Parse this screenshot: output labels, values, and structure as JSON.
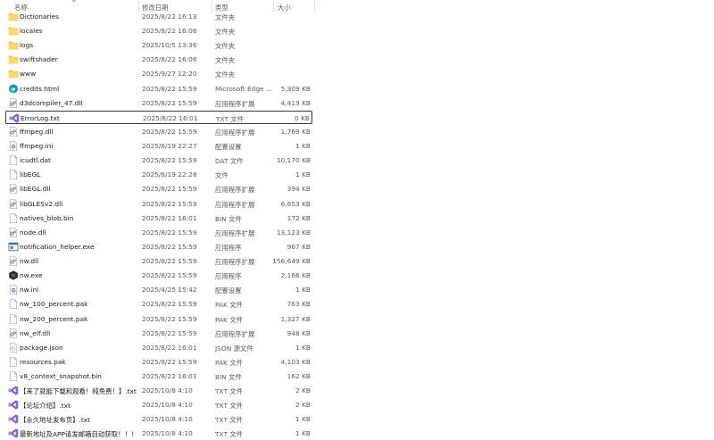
{
  "columns": {
    "name": "名称",
    "date": "修改日期",
    "type": "类型",
    "size": "大小"
  },
  "files": [
    {
      "name": "Dictionaries",
      "date": "2025/8/22 16:13",
      "type": "文件夹",
      "size": "",
      "icon": "folder-icon"
    },
    {
      "name": "locales",
      "date": "2025/8/22 16:06",
      "type": "文件夹",
      "size": "",
      "icon": "folder-icon"
    },
    {
      "name": "logs",
      "date": "2025/10/5 13:36",
      "type": "文件夹",
      "size": "",
      "icon": "folder-icon"
    },
    {
      "name": "swiftshader",
      "date": "2025/8/22 16:06",
      "type": "文件夹",
      "size": "",
      "icon": "folder-icon"
    },
    {
      "name": "www",
      "date": "2025/9/27 12:20",
      "type": "文件夹",
      "size": "",
      "icon": "folder-icon"
    },
    {
      "name": "credits.html",
      "date": "2025/8/22 15:59",
      "type": "Microsoft Edge ...",
      "size": "5,309 KB",
      "icon": "edge-icon"
    },
    {
      "name": "d3dcompiler_47.dll",
      "date": "2025/8/22 15:59",
      "type": "应用程序扩展",
      "size": "4,419 KB",
      "icon": "dll-icon"
    },
    {
      "name": "ErrorLog.txt",
      "date": "2025/8/22 16:01",
      "type": "TXT 文件",
      "size": "0 KB",
      "icon": "vs-icon",
      "selected": true
    },
    {
      "name": "ffmpeg.dll",
      "date": "2025/8/22 15:59",
      "type": "应用程序扩展",
      "size": "1,769 KB",
      "icon": "dll-icon"
    },
    {
      "name": "ffmpeg.ini",
      "date": "2025/8/19 22:27",
      "type": "配置设置",
      "size": "1 KB",
      "icon": "ini-icon"
    },
    {
      "name": "icudtl.dat",
      "date": "2025/8/22 15:59",
      "type": "DAT 文件",
      "size": "10,170 KB",
      "icon": "file-icon"
    },
    {
      "name": "libEGL",
      "date": "2025/8/19 22:28",
      "type": "文件",
      "size": "1 KB",
      "icon": "file-icon"
    },
    {
      "name": "libEGL.dll",
      "date": "2025/8/22 15:59",
      "type": "应用程序扩展",
      "size": "394 KB",
      "icon": "dll-icon"
    },
    {
      "name": "libGLESv2.dll",
      "date": "2025/8/22 15:59",
      "type": "应用程序扩展",
      "size": "6,653 KB",
      "icon": "dll-icon"
    },
    {
      "name": "natives_blob.bin",
      "date": "2025/8/22 16:01",
      "type": "BIN 文件",
      "size": "172 KB",
      "icon": "file-icon"
    },
    {
      "name": "node.dll",
      "date": "2025/8/22 15:59",
      "type": "应用程序扩展",
      "size": "13,123 KB",
      "icon": "dll-icon"
    },
    {
      "name": "notification_helper.exe",
      "date": "2025/8/22 15:59",
      "type": "应用程序",
      "size": "967 KB",
      "icon": "app-window-icon"
    },
    {
      "name": "nw.dll",
      "date": "2025/8/22 15:59",
      "type": "应用程序扩展",
      "size": "156,649 KB",
      "icon": "dll-icon"
    },
    {
      "name": "nw.exe",
      "date": "2025/8/22 15:59",
      "type": "应用程序",
      "size": "2,166 KB",
      "icon": "nw-hexagon-icon"
    },
    {
      "name": "nw.ini",
      "date": "2025/4/25 15:42",
      "type": "配置设置",
      "size": "1 KB",
      "icon": "ini-icon"
    },
    {
      "name": "nw_100_percent.pak",
      "date": "2025/8/22 15:59",
      "type": "PAK 文件",
      "size": "763 KB",
      "icon": "file-icon"
    },
    {
      "name": "nw_200_percent.pak",
      "date": "2025/8/22 15:59",
      "type": "PAK 文件",
      "size": "1,327 KB",
      "icon": "file-icon"
    },
    {
      "name": "nw_elf.dll",
      "date": "2025/8/22 15:59",
      "type": "应用程序扩展",
      "size": "948 KB",
      "icon": "dll-icon"
    },
    {
      "name": "package.json",
      "date": "2025/8/22 16:01",
      "type": "JSON 源文件",
      "size": "1 KB",
      "icon": "json-icon"
    },
    {
      "name": "resources.pak",
      "date": "2025/8/22 15:59",
      "type": "PAK 文件",
      "size": "4,103 KB",
      "icon": "file-icon"
    },
    {
      "name": "v8_context_snapshot.bin",
      "date": "2025/8/22 16:01",
      "type": "BIN 文件",
      "size": "162 KB",
      "icon": "file-icon"
    },
    {
      "name": "【来了就能下载和观看！纯免费！】.txt",
      "date": "2025/10/8 4:10",
      "type": "TXT 文件",
      "size": "2 KB",
      "icon": "vs-icon"
    },
    {
      "name": "【论坛介绍】.txt",
      "date": "2025/10/8 4:10",
      "type": "TXT 文件",
      "size": "2 KB",
      "icon": "vs-icon"
    },
    {
      "name": "【永久地址发布页】.txt",
      "date": "2025/10/8 4:10",
      "type": "TXT 文件",
      "size": "1 KB",
      "icon": "vs-icon"
    },
    {
      "name": "最新地址及APP请发邮箱自动获取！！！ ...",
      "date": "2025/10/8 4:10",
      "type": "TXT 文件",
      "size": "1 KB",
      "icon": "vs-icon"
    }
  ]
}
